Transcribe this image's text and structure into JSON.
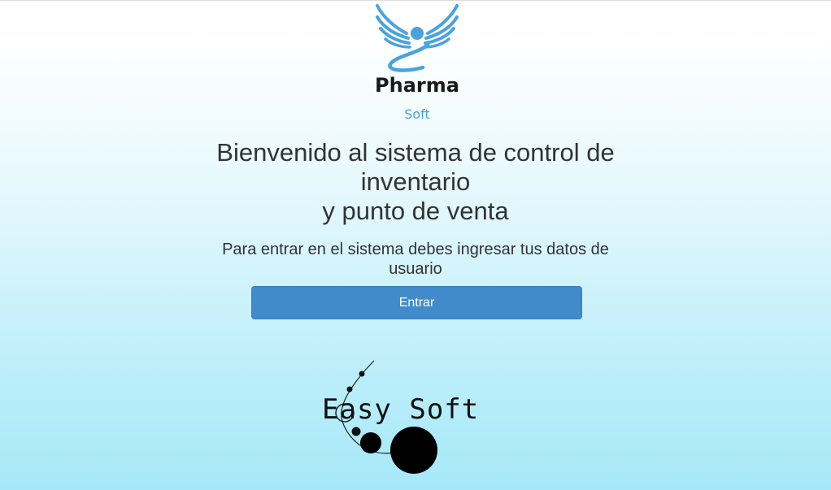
{
  "branding": {
    "product_name": "Pharma",
    "product_sub": "Soft",
    "company_name": "Easy Soft"
  },
  "welcome": {
    "title_line1": "Bienvenido al sistema de control de",
    "title_line2": "inventario",
    "title_line3": "y punto de venta",
    "instructions": "Para entrar en el sistema debes ingresar tus datos de usuario"
  },
  "actions": {
    "enter_label": "Entrar"
  },
  "colors": {
    "button_bg": "#428bca",
    "logo_blue": "#4a9fd6",
    "background_bottom": "#a6e8f8"
  },
  "icons": {
    "pharma_logo": "winged-angel-icon",
    "easysoft_logo": "orbit-planets-icon"
  }
}
